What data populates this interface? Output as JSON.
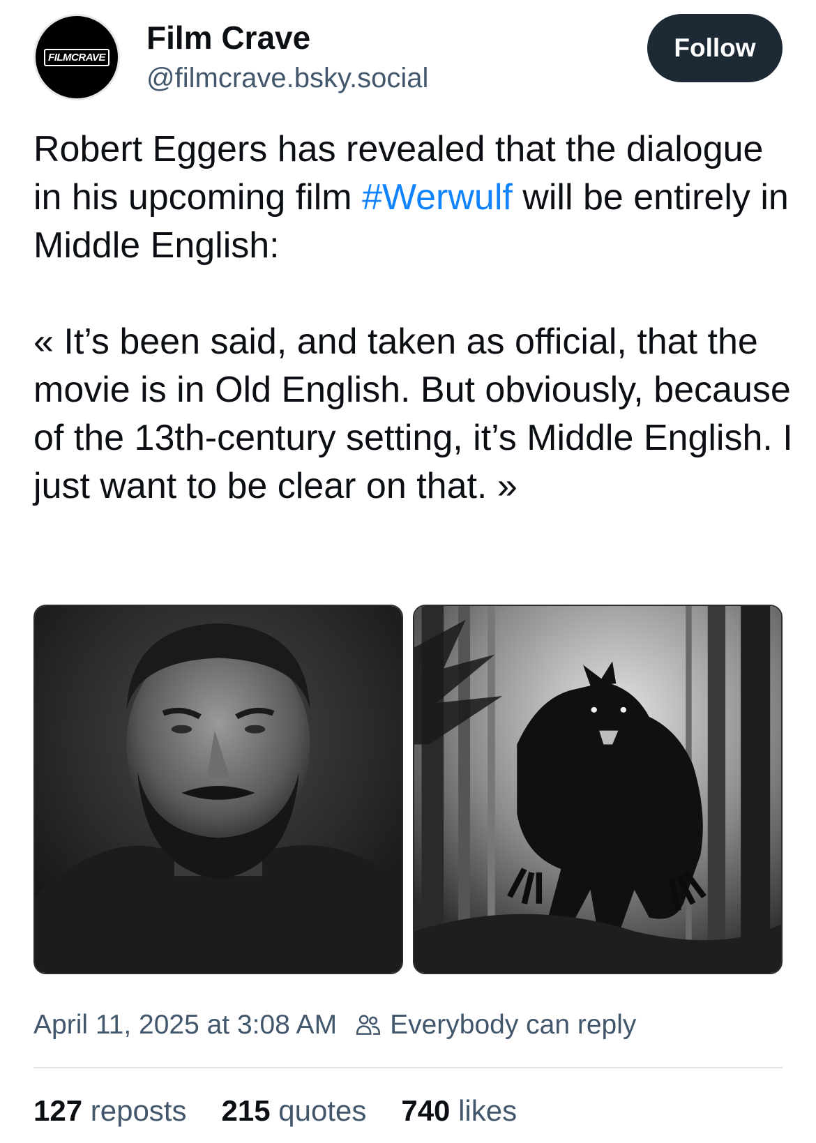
{
  "author": {
    "display_name": "Film Crave",
    "handle": "@filmcrave.bsky.social",
    "avatar_logo_text": "FILMCRAVE"
  },
  "follow_label": "Follow",
  "post": {
    "paragraphs": [
      {
        "before": "Robert Eggers has revealed that the dialogue in his upcoming film ",
        "hashtag": "#Werwulf",
        "after": " will be entirely in Middle English:"
      },
      {
        "text": "« It’s been said, and taken as official, that the movie is in Old English. But obviously, because of the 13th-century setting, it’s Middle English. I just want to be clear on that. »"
      }
    ]
  },
  "images": [
    {
      "icon": "portrait-photo",
      "description_name": "robert-eggers-portrait"
    },
    {
      "icon": "werewolf-photo",
      "description_name": "werewolf-forest-image"
    }
  ],
  "meta": {
    "timestamp": "April 11, 2025 at 3:08 AM",
    "reply_setting": "Everybody can reply"
  },
  "stats": [
    {
      "count": "127",
      "label": "reposts"
    },
    {
      "count": "215",
      "label": "quotes"
    },
    {
      "count": "740",
      "label": "likes"
    }
  ],
  "colors": {
    "accent_link": "#1083fe",
    "follow_button_bg": "#1e2936",
    "secondary_text": "#42576c"
  }
}
